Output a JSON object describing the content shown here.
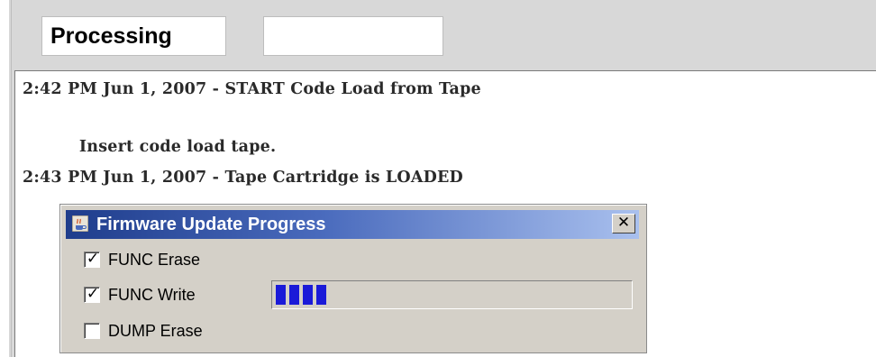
{
  "status": {
    "label": "Processing",
    "value": ""
  },
  "log": {
    "lines": [
      "2:42 PM Jun 1, 2007 - START Code Load from Tape",
      "",
      "          Insert code load tape.",
      "2:43 PM Jun 1, 2007 - Tape Cartridge is LOADED"
    ]
  },
  "dialog": {
    "title": "Firmware Update Progress",
    "title_icon": "java-coffee-cup-icon",
    "close_glyph": "✕",
    "items": [
      {
        "label": "FUNC Erase",
        "checked": true
      },
      {
        "label": "FUNC Write",
        "checked": true
      },
      {
        "label": "DUMP Erase",
        "checked": false
      }
    ],
    "progress": {
      "fraction": 0.09,
      "block_count": 4,
      "fill_color": "#1a1ad8"
    },
    "title_gradient_start": "#1f3d8c",
    "title_gradient_end": "#a9c0ee"
  }
}
